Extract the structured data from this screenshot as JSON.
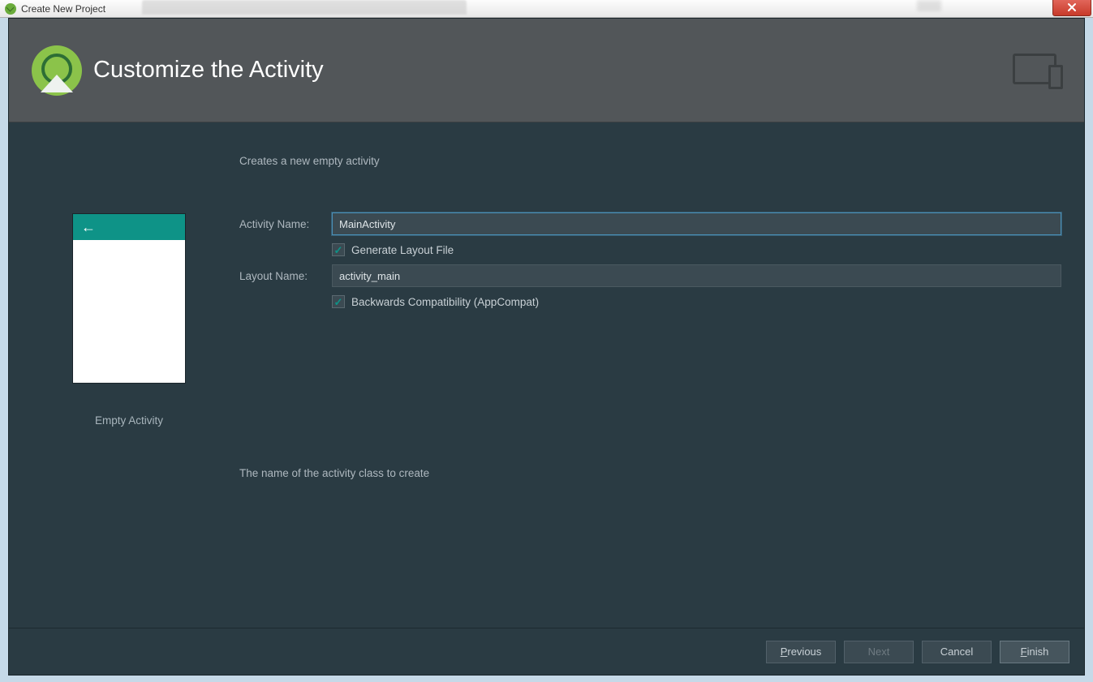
{
  "window": {
    "title": "Create New Project"
  },
  "header": {
    "title": "Customize the Activity"
  },
  "description": "Creates a new empty activity",
  "preview": {
    "label": "Empty Activity"
  },
  "form": {
    "activity_name_label": "Activity Name:",
    "activity_name_value": "MainActivity",
    "generate_layout_label": "Generate Layout File",
    "layout_name_label": "Layout Name:",
    "layout_name_value": "activity_main",
    "backwards_compat_label": "Backwards Compatibility (AppCompat)"
  },
  "help_text": "The name of the activity class to create",
  "buttons": {
    "previous": "Previous",
    "next": "Next",
    "cancel": "Cancel",
    "finish": "Finish"
  }
}
